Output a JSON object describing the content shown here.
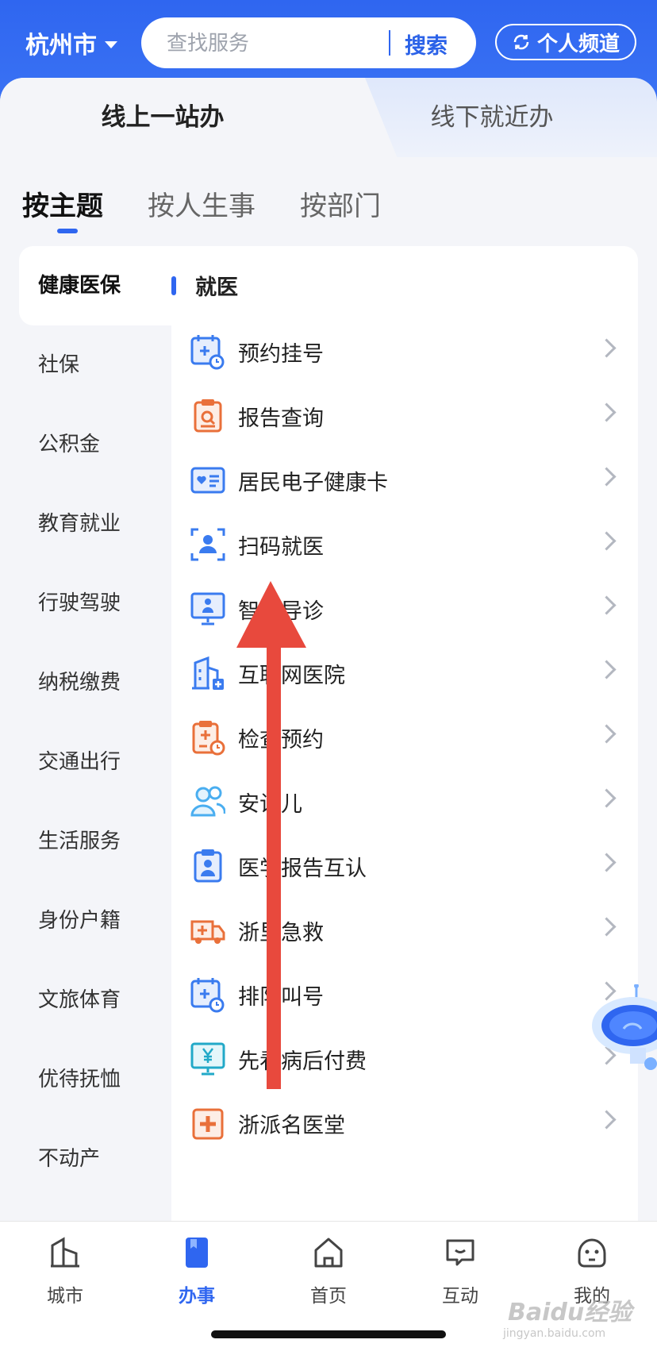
{
  "header": {
    "city": "杭州市",
    "search_placeholder": "查找服务",
    "search_button": "搜索",
    "channel_button": "个人频道"
  },
  "mode_tabs": [
    {
      "label": "线上一站办",
      "active": true
    },
    {
      "label": "线下就近办",
      "active": false
    }
  ],
  "category_tabs": [
    {
      "label": "按主题",
      "active": true
    },
    {
      "label": "按人生事",
      "active": false
    },
    {
      "label": "按部门",
      "active": false
    }
  ],
  "sidebar": {
    "items": [
      {
        "label": "健康医保",
        "active": true
      },
      {
        "label": "社保"
      },
      {
        "label": "公积金"
      },
      {
        "label": "教育就业"
      },
      {
        "label": "行驶驾驶"
      },
      {
        "label": "纳税缴费"
      },
      {
        "label": "交通出行"
      },
      {
        "label": "生活服务"
      },
      {
        "label": "身份户籍"
      },
      {
        "label": "文旅体育"
      },
      {
        "label": "优待抚恤"
      },
      {
        "label": "不动产"
      }
    ]
  },
  "panel": {
    "section_title": "就医",
    "services": [
      {
        "label": "预约挂号",
        "icon": "calendar-clock-icon"
      },
      {
        "label": "报告查询",
        "icon": "clipboard-search-icon"
      },
      {
        "label": "居民电子健康卡",
        "icon": "health-card-icon"
      },
      {
        "label": "扫码就医",
        "icon": "scan-person-icon"
      },
      {
        "label": "智能导诊",
        "icon": "monitor-doctor-icon"
      },
      {
        "label": "互联网医院",
        "icon": "hospital-building-icon"
      },
      {
        "label": "检查预约",
        "icon": "clipboard-clock-icon"
      },
      {
        "label": "安诊儿",
        "icon": "people-icon"
      },
      {
        "label": "医学报告互认",
        "icon": "report-person-icon"
      },
      {
        "label": "浙里急救",
        "icon": "ambulance-icon"
      },
      {
        "label": "排队叫号",
        "icon": "calendar-clock-icon"
      },
      {
        "label": "先看病后付费",
        "icon": "monitor-yen-icon"
      },
      {
        "label": "浙派名医堂",
        "icon": "cross-box-icon"
      }
    ]
  },
  "tabbar": [
    {
      "label": "城市",
      "icon": "city-icon"
    },
    {
      "label": "办事",
      "icon": "bookmark-icon",
      "active": true
    },
    {
      "label": "首页",
      "icon": "home-icon"
    },
    {
      "label": "互动",
      "icon": "chat-icon"
    },
    {
      "label": "我的",
      "icon": "face-icon"
    }
  ],
  "watermark": {
    "text": "Baidu经验",
    "sub": "jingyan.baidu.com"
  },
  "colors": {
    "accent": "#2f66f0",
    "annotation_arrow": "#e8493d"
  }
}
